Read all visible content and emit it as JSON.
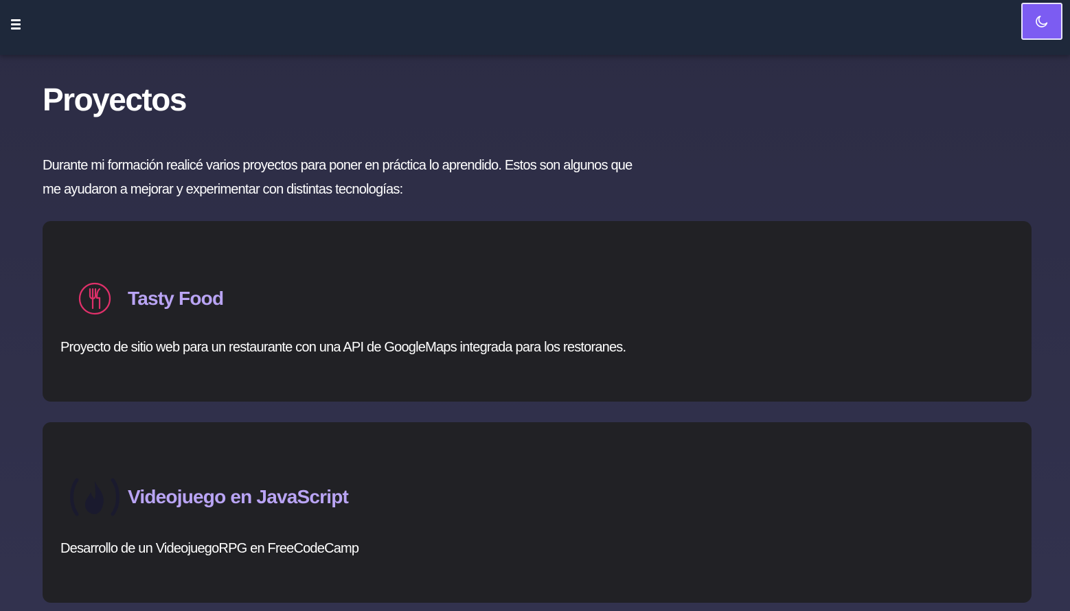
{
  "header": {
    "menu_icon": "hamburger-menu-icon",
    "theme_icon": "moon-icon",
    "theme_button_color": "#7c5cf2"
  },
  "main": {
    "title": "Proyectos",
    "intro": "Durante mi formación realicé varios proyectos para poner en práctica lo aprendido. Estos son algunos que me ayudaron a mejorar y experimentar con distintas tecnologías:"
  },
  "projects": [
    {
      "title": "Tasty Food",
      "description": "Proyecto de sitio web para un restaurante con una API de GoogleMaps integrada para los restoranes.",
      "icon": "restaurant-icon",
      "icon_color": "#e0306a"
    },
    {
      "title": "Videojuego en JavaScript",
      "description": "Desarrollo de un VideojuegoRPG en FreeCodeCamp",
      "icon": "freecodecamp-icon",
      "icon_color": "#1a1a2e"
    }
  ],
  "colors": {
    "background": "#2e2e48",
    "topbar": "#1e283a",
    "card": "#212125",
    "project_title": "#b9a4f4"
  }
}
